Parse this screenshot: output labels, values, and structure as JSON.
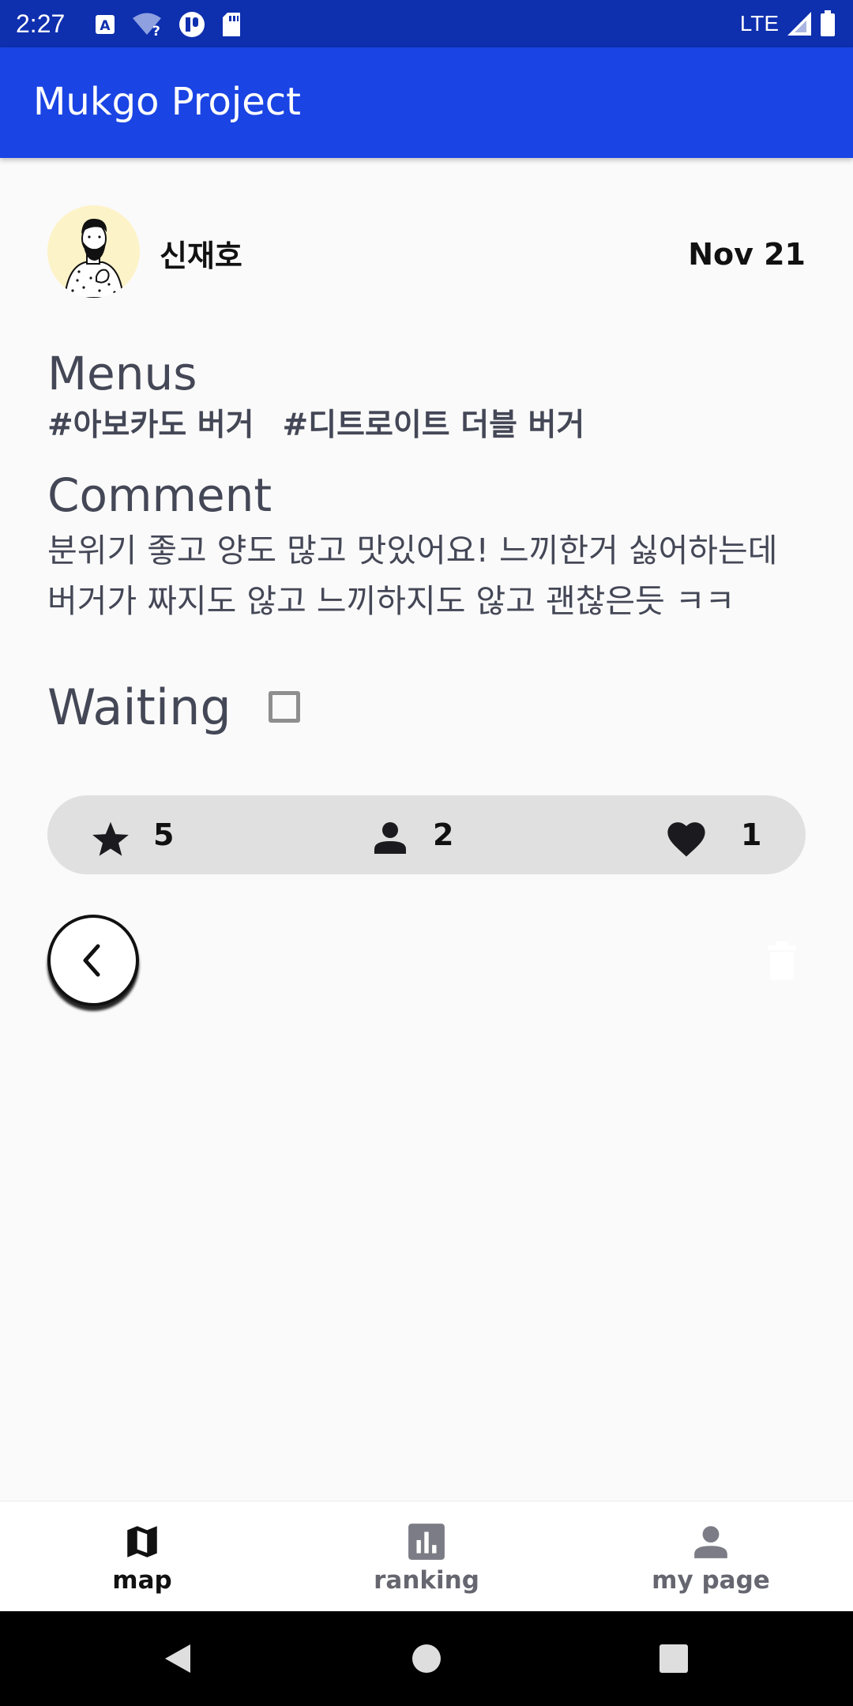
{
  "status_bar": {
    "time": "2:27",
    "network": "LTE",
    "left_icons": [
      "accessibility-icon",
      "wifi-question-icon",
      "circle-app-icon",
      "sd-card-icon"
    ],
    "right_icons": [
      "signal-icon",
      "battery-icon"
    ]
  },
  "app_bar": {
    "title": "Mukgo Project",
    "color": "#1a44e3"
  },
  "post": {
    "author": "신재호",
    "date": "Nov 21",
    "menus_title": "Menus",
    "menu_tags": [
      "#아보카도 버거",
      "#디트로이트 더블 버거"
    ],
    "comment_title": "Comment",
    "comment_lines": [
      "분위기 좋고 양도 많고 맛있어요! 느끼한거 싫어하는데",
      "버거가 짜지도 않고 느끼하지도 않고 괜찮은듯 ㅋㅋ"
    ],
    "waiting_label": "Waiting",
    "waiting_checked": false
  },
  "stats": {
    "rating": "5",
    "people": "2",
    "likes": "1"
  },
  "actions": {
    "back_icon": "chevron-left-icon",
    "delete_icon": "trash-icon"
  },
  "bottom_nav": {
    "items": [
      {
        "label": "map",
        "icon": "map-icon",
        "active": true
      },
      {
        "label": "ranking",
        "icon": "bar-chart-icon",
        "active": false
      },
      {
        "label": "my page",
        "icon": "person-icon",
        "active": false
      }
    ]
  }
}
